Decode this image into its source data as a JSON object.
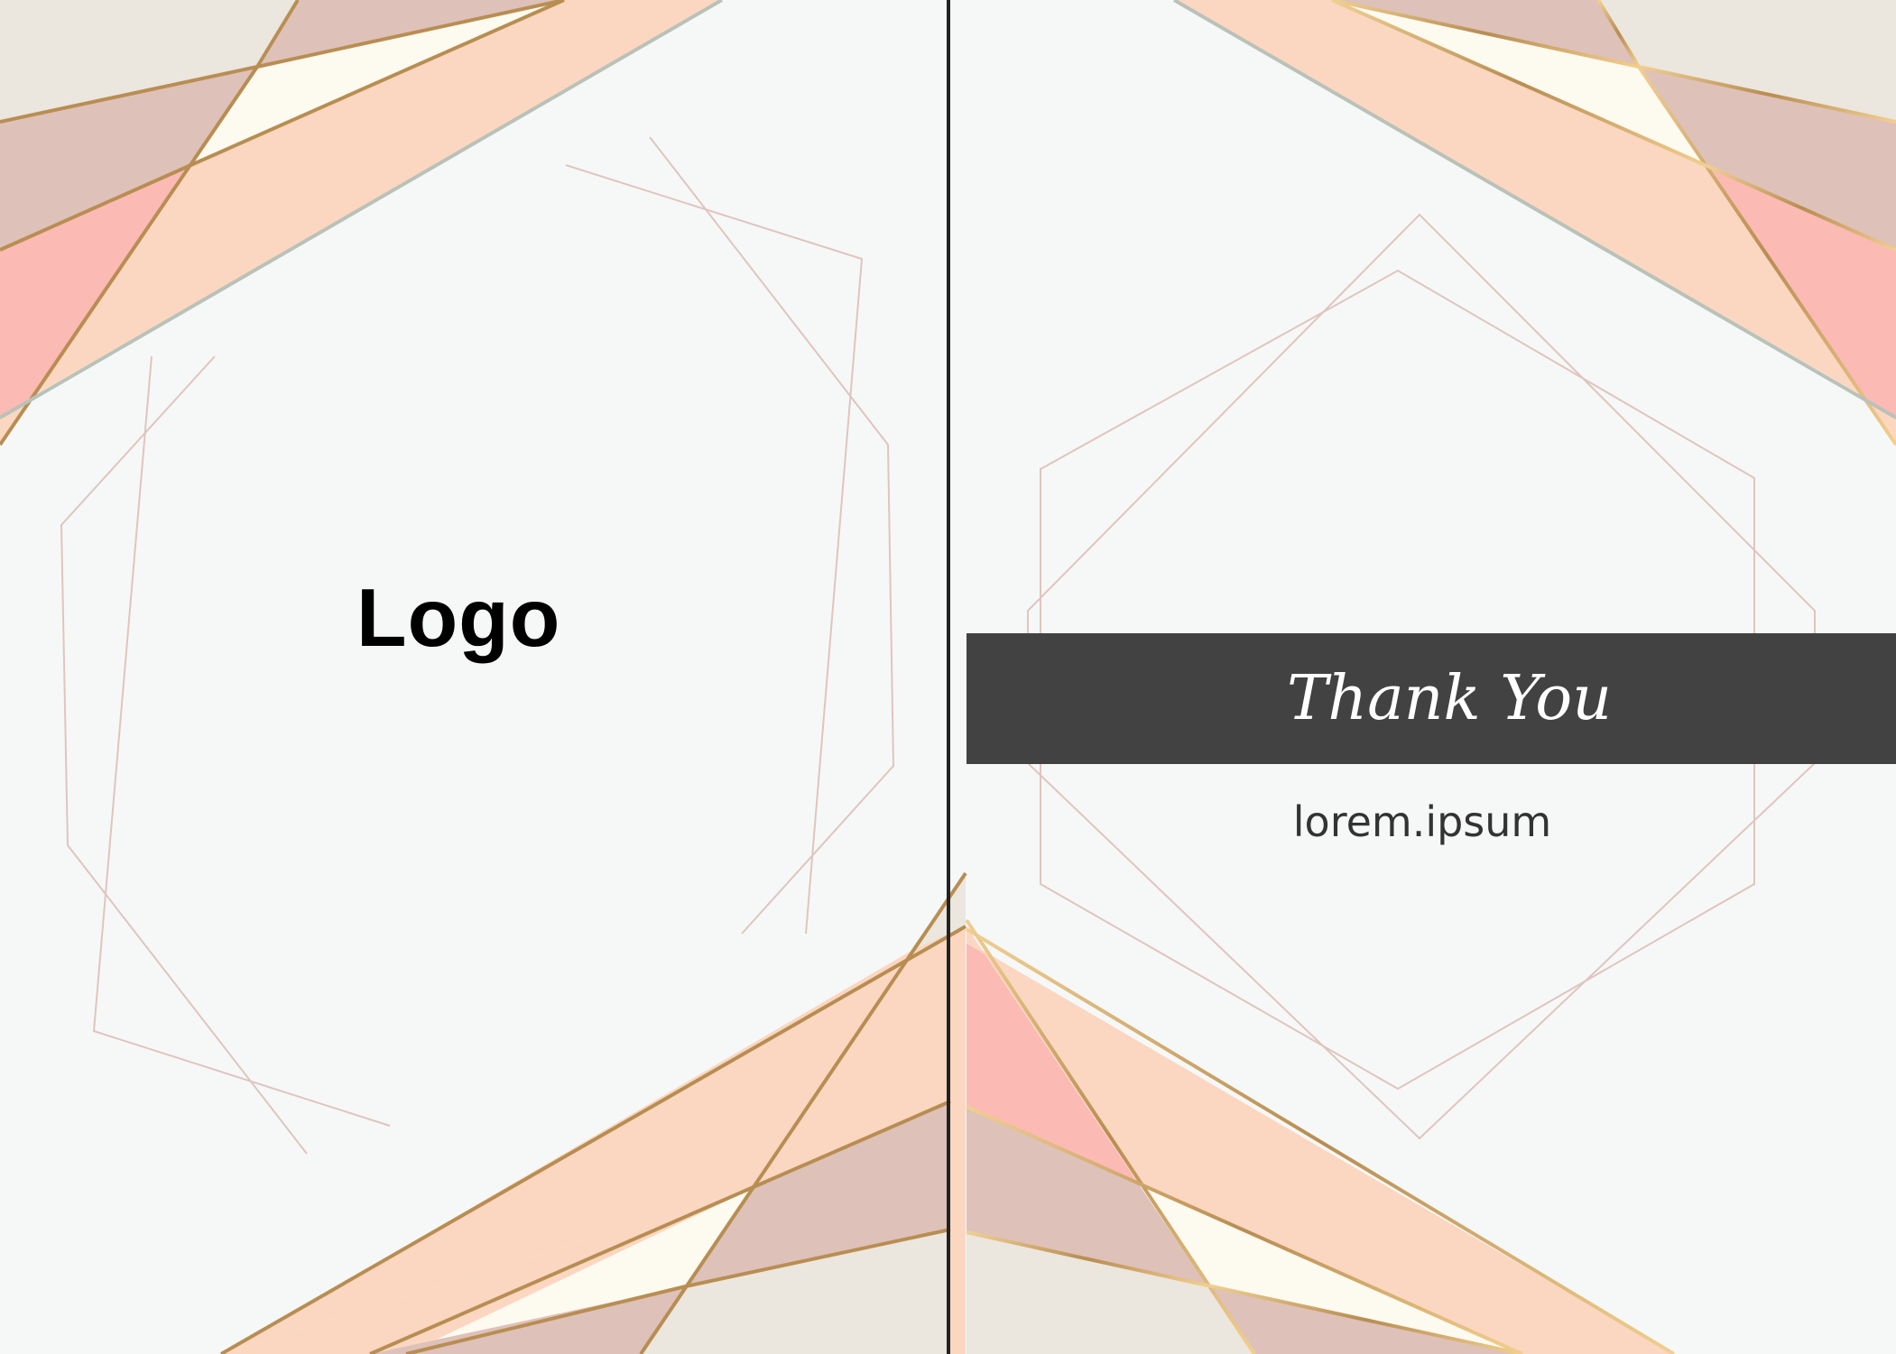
{
  "card": {
    "logo_text": "Logo",
    "thank_you_text": "Thank You",
    "website_text": "lorem.ipsum"
  },
  "palette": {
    "background": "#f6f8f7",
    "blush": "#fbd7c1",
    "coral": "#fbbab4",
    "mauve": "#dec1b9",
    "cream": "#fdfaef",
    "greige": "#ebe6de",
    "gold": "#d9b174",
    "line": "#dfc5be",
    "fold_line": "#222222",
    "banner": "#424242",
    "banner_text": "#ffffff"
  }
}
